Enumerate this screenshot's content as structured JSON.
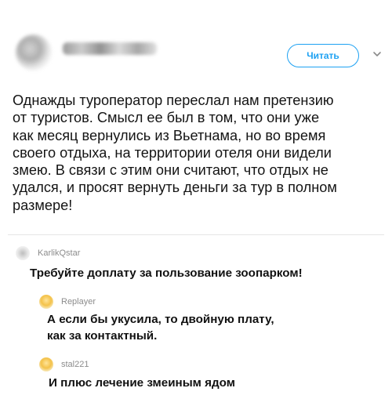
{
  "tweet": {
    "follow_label": "Читать",
    "text": "Однажды туроператор переслал нам претензию\nот туристов. Смысл ее был в том, что они уже\nкак месяц вернулись из Вьетнама, но во время\nсвоего отдыха, на территории отеля они видели\nзмею. В связи с этим они считают, что отдых не\nудался, и просят вернуть деньги за тур в полном\nразмере!"
  },
  "comments": [
    {
      "username": "KarlikQstar",
      "text": "Требуйте доплату за пользование зоопарком!"
    },
    {
      "username": "Replayer",
      "text": "А если бы укусила, то двойную плату,\nкак за контактный."
    },
    {
      "username": "stal221",
      "text": "И плюс лечение змеиным ядом"
    }
  ],
  "colors": {
    "accent": "#1da1f2",
    "text": "#111111",
    "muted": "#8c8c8c",
    "divider": "#e6e6e6"
  },
  "icons": {
    "chevron": "chevron-down-icon",
    "avatar_placeholder": "avatar"
  }
}
